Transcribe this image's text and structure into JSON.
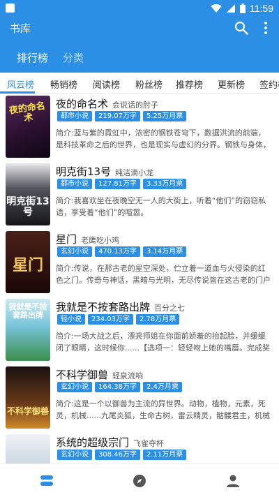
{
  "status_bar": {
    "time": "11:59"
  },
  "app_bar": {
    "title": "书库",
    "search_icon": "search-icon",
    "more_icon": "more-vert-icon"
  },
  "sub_tabs": [
    {
      "label": "排行榜",
      "active": true
    },
    {
      "label": "分类",
      "active": false
    }
  ],
  "category_tabs": [
    {
      "label": "风云榜",
      "active": true
    },
    {
      "label": "畅销榜",
      "active": false
    },
    {
      "label": "阅读榜",
      "active": false
    },
    {
      "label": "粉丝榜",
      "active": false
    },
    {
      "label": "推荐榜",
      "active": false
    },
    {
      "label": "更新榜",
      "active": false
    },
    {
      "label": "签约榜",
      "active": false
    }
  ],
  "books": [
    {
      "title": "夜的命名术",
      "author": "会说话的肘子",
      "tags": [
        "都市小说",
        "219.07万字",
        "5.25万月票"
      ],
      "desc": "简介:蓝与紫的霓虹中，浓密的钢铁苍穹下，数据洪流的前端，是科技革命之后的世界，也是现实与虚幻的分界。钢铁与身体，过去与未..."
    },
    {
      "title": "明克街13号",
      "author": "纯洁滴小龙",
      "tags": [
        "都市小说",
        "127.81万字",
        "3.33万月票"
      ],
      "desc": "简介:我喜欢坐在夜晚空无一人的大街上，听着“他们”的窃窃私语，享受着“他们”的喧嚣。"
    },
    {
      "title": "星门",
      "author": "老鹰吃小鸡",
      "tags": [
        "玄幻小说",
        "470.13万字",
        "3.14万月票"
      ],
      "desc": "简介:传说，在那古老的星空深处，伫立着一道血与火侵染的红色之门。传奇与神话，黑暗与光明，无尽传说皆在这古老的门户中流淌。..."
    },
    {
      "title": "我就是不按套路出牌",
      "author": "百分之七",
      "tags": [
        "轻小说",
        "234.03万字",
        "2.78万月票"
      ],
      "desc": "简介:一场大战之后，漂亮师姐在你面前娇羞的抬起脸，并缓缓闭了眼睛，这时候你......【选项一：轻轻吻上她的嘴唇。完成奖励：千叶魂..."
    },
    {
      "title": "不科学御兽",
      "author": "轻泉流响",
      "tags": [
        "玄幻小说",
        "164.38万字",
        "2.4万月票"
      ],
      "desc": "简介:这是一个以御兽为主流的异世界。动物，植物，元素，死灵，机械......九尾炎狐，生命古树，雷云精灵，骷髅君主，机械舰娘乃至孕..."
    },
    {
      "title": "系统的超级宗门",
      "author": "飞雀夺杯",
      "tags": [
        "玄幻小说",
        "308.46万字",
        "2.11万月票"
      ],
      "desc": ""
    }
  ],
  "covers": [
    {
      "text": "夜的命名术",
      "color": "#3a1b3f"
    },
    {
      "text": "明克街13号",
      "color": "#1e1e2a"
    },
    {
      "text": "星门",
      "color": "#2a1110"
    },
    {
      "text": "我就是不按套路出牌",
      "color": "#3fa7c8"
    },
    {
      "text": "不科学御兽",
      "color": "#2b1a12"
    },
    {
      "text": "",
      "color": "#c9d6e2"
    }
  ],
  "bottom_nav": [
    {
      "icon": "bookshelf-icon",
      "active": true
    },
    {
      "icon": "compass-icon",
      "active": false
    },
    {
      "icon": "person-icon",
      "active": false
    }
  ],
  "colors": {
    "primary": "#2c8fe6",
    "tag_bg": "#2c8fe6"
  }
}
